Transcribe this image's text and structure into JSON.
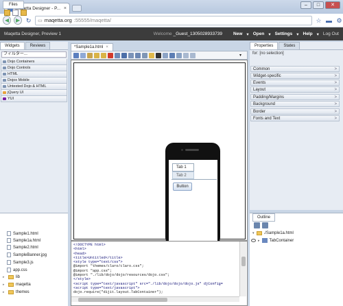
{
  "browser": {
    "tab_title": "Maqetta Designer - P...",
    "tab_close": "×",
    "url_host": "maqetta.org",
    "url_path": ":55555/maqetta/"
  },
  "header": {
    "brand": "Maqetta Designer, Preview 1",
    "welcome_prefix": "Welcome",
    "username": "_Guest_1305028933739",
    "menus": [
      "New",
      "Open",
      "Settings",
      "Help"
    ],
    "logout": "Log Out"
  },
  "left": {
    "tabs": [
      "Widgets",
      "Reviews"
    ],
    "filter_placeholder": "フィルター...",
    "categories": [
      "Dojo Containers",
      "Dojo Controls",
      "HTML",
      "Dojox Mobile",
      "Untested Dojo & HTML",
      "jQuery UI",
      "YUI"
    ]
  },
  "files": {
    "tab": "Files",
    "items": [
      {
        "name": "Sample1.html",
        "type": "file"
      },
      {
        "name": "Sample1a.html",
        "type": "file"
      },
      {
        "name": "Sample2.html",
        "type": "file"
      },
      {
        "name": "SampleBanner.jpg",
        "type": "file"
      },
      {
        "name": "Sample3.js",
        "type": "file"
      },
      {
        "name": "app.css",
        "type": "file"
      },
      {
        "name": "lib",
        "type": "folder"
      },
      {
        "name": "maqetta",
        "type": "folder"
      },
      {
        "name": "themes",
        "type": "folder"
      }
    ]
  },
  "editor": {
    "tab_title": "*Sample1a.html",
    "tab_close": "×",
    "mobile": {
      "tabs": [
        "Tab 1",
        "Tab 2"
      ],
      "button": "Button"
    },
    "source_lines": [
      "<!DOCTYPE html>",
      "<html>",
      "<head>",
      "<title>Untitled</title>",
      "<style type=\"text/css\">",
      "@import \"themes/claro/claro.css\";",
      "@import \"app.css\";",
      "@import \"./lib/dojo/dojo/resources/dojo.css\";",
      "</style>",
      "<script type=\"text/javascript\" src=\"./lib/dojo/dojo/dojo.js\" djConfig=",
      "<script type=\"text/javascript\">",
      "dojo.require(\"dijit.layout.TabContainer\");"
    ]
  },
  "right": {
    "tabs": [
      "Properties",
      "States"
    ],
    "for_label": "for:",
    "for_value": "[no selection]",
    "sections": [
      "Common",
      "Widget-specific",
      "Events",
      "Layout",
      "Padding/Margins",
      "Background",
      "Border",
      "Fonts and Text"
    ]
  },
  "outline": {
    "tab": "Outline",
    "root": "./Sample1a.html",
    "child": "TabContainer"
  }
}
